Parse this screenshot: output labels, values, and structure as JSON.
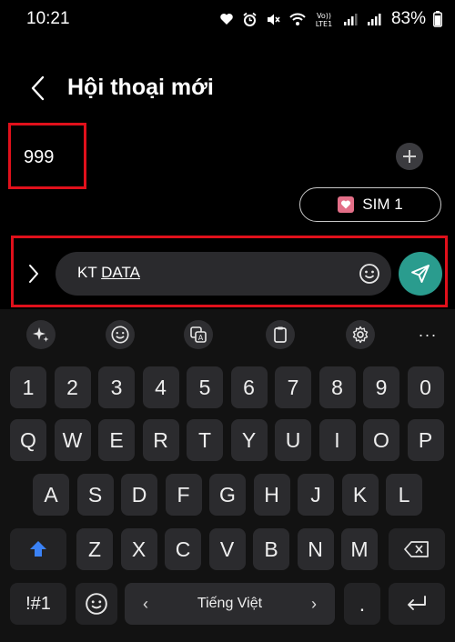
{
  "status_bar": {
    "time": "10:21",
    "battery": "83%"
  },
  "header": {
    "title": "Hội thoại mới"
  },
  "recipient": {
    "value": "999"
  },
  "sim": {
    "label": "SIM 1"
  },
  "compose": {
    "text_plain": "KT ",
    "text_underlined": "DATA"
  },
  "keyboard": {
    "number_row": [
      "1",
      "2",
      "3",
      "4",
      "5",
      "6",
      "7",
      "8",
      "9",
      "0"
    ],
    "row1": [
      "Q",
      "W",
      "E",
      "R",
      "T",
      "Y",
      "U",
      "I",
      "O",
      "P"
    ],
    "row2": [
      "A",
      "S",
      "D",
      "F",
      "G",
      "H",
      "J",
      "K",
      "L"
    ],
    "row3": [
      "Z",
      "X",
      "C",
      "V",
      "B",
      "N",
      "M"
    ],
    "symbols_label": "!#1",
    "space_label": "Tiếng Việt",
    "period_label": ".",
    "more_label": "···"
  },
  "colors": {
    "accent_send": "#2a9c8e",
    "highlight": "#e0101b",
    "sim_icon": "#e36f88"
  }
}
